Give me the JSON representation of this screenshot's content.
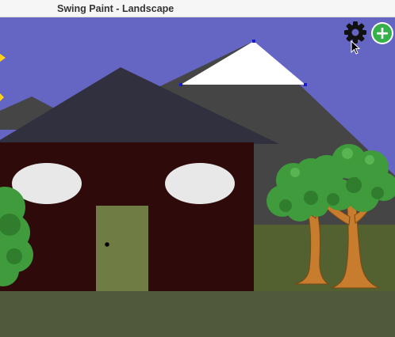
{
  "window": {
    "title": "Swing Paint - Landscape"
  },
  "toolbar": {
    "settings_icon": "gear-icon",
    "add_icon": "plus-icon",
    "add_symbol": "+"
  },
  "colors": {
    "sky": "#6565c4",
    "mountain": "#454545",
    "snow": "#ffffff",
    "roof": "#30303f",
    "house_wall": "#2e0a0a",
    "window": "#e8e8e8",
    "door": "#6f7d44",
    "ground": "#566234",
    "tree_foliage": "#3f9b3c",
    "tree_trunk": "#c77c2e",
    "sun": "#ffd21a",
    "selection_handle": "#1a1ad0",
    "add_button": "#35b04a"
  }
}
